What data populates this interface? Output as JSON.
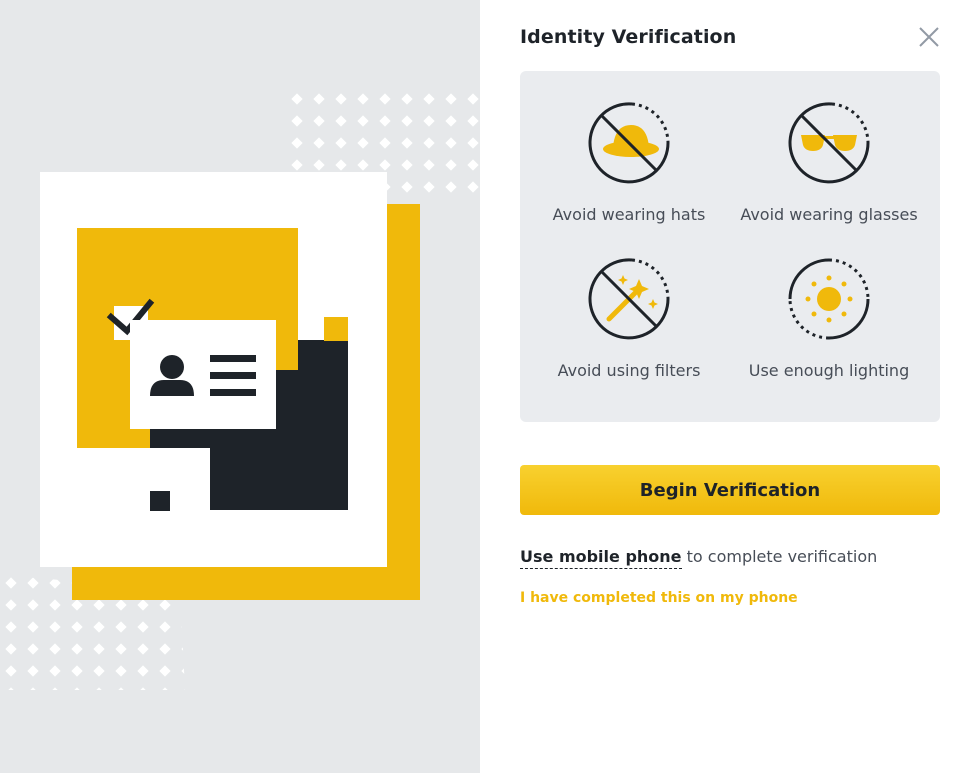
{
  "dialog": {
    "title": "Identity Verification",
    "close_icon": "close-icon"
  },
  "tips": [
    {
      "label": "Avoid wearing hats",
      "icon": "no-hat-icon"
    },
    {
      "label": "Avoid wearing glasses",
      "icon": "no-glasses-icon"
    },
    {
      "label": "Avoid using filters",
      "icon": "no-filter-icon"
    },
    {
      "label": "Use enough lighting",
      "icon": "sun-icon"
    }
  ],
  "actions": {
    "begin_label": "Begin Verification",
    "mobile_link": "Use mobile phone",
    "mobile_suffix": " to complete verification",
    "completed_link": "I have completed this on my phone"
  },
  "colors": {
    "accent": "#F0B90B",
    "dark": "#1E2329",
    "panel": "#EAECEF",
    "left_background": "#E6E8EA"
  }
}
